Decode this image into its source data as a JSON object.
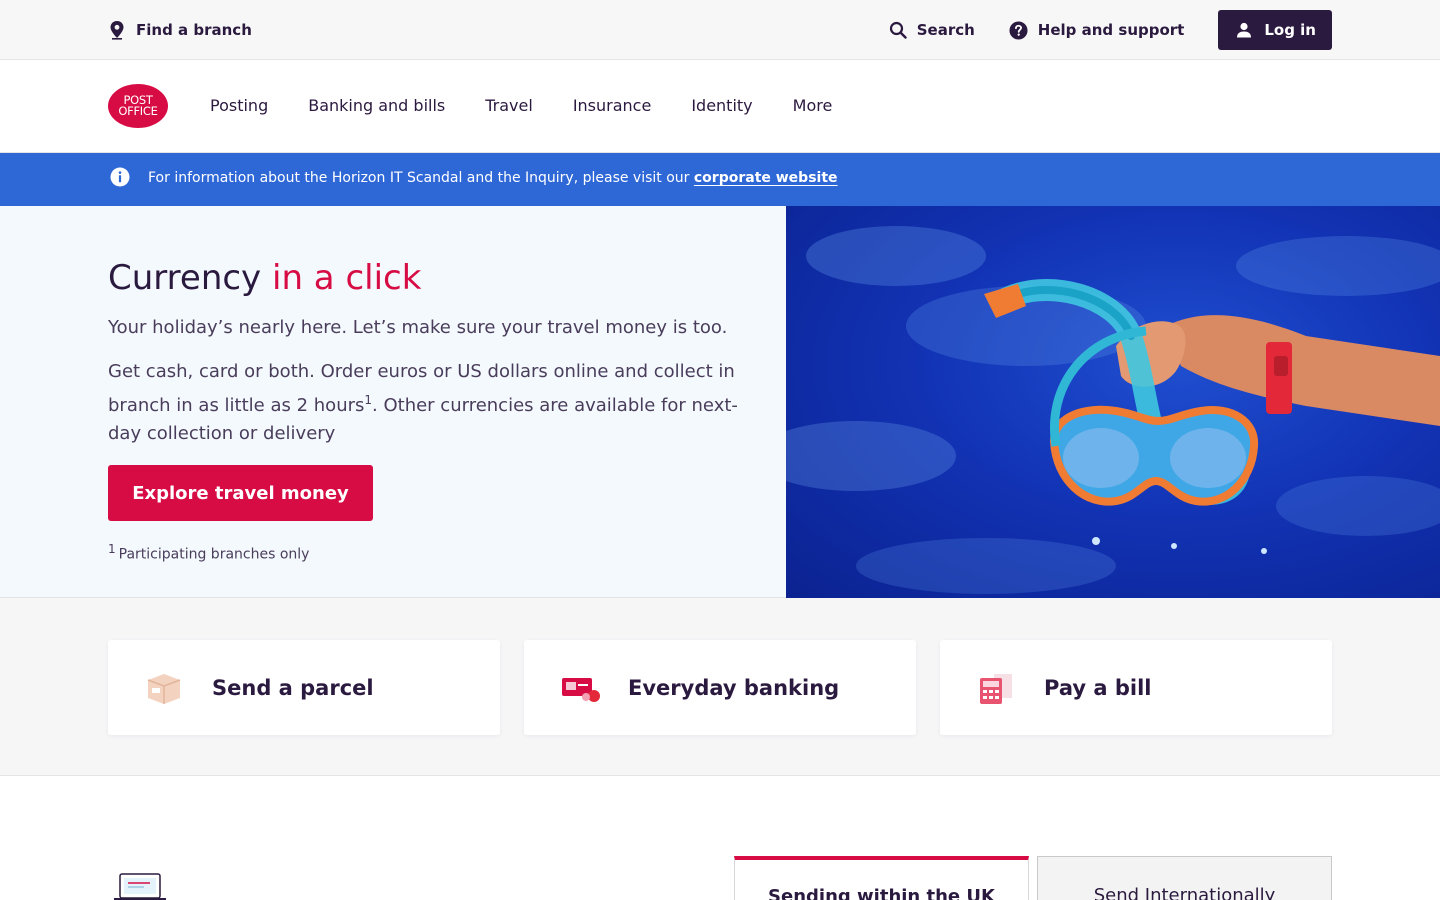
{
  "topbar": {
    "find_branch": "Find a branch",
    "search": "Search",
    "help": "Help and support",
    "login": "Log in"
  },
  "logo": {
    "line1": "POST",
    "line2": "OFFICE"
  },
  "nav": [
    "Posting",
    "Banking and bills",
    "Travel",
    "Insurance",
    "Identity",
    "More"
  ],
  "banner": {
    "text": "For information about the Horizon IT Scandal and the Inquiry, please visit our ",
    "link": "corporate website"
  },
  "hero": {
    "title_plain": "Currency ",
    "title_accent": "in a click",
    "p1": "Your holiday’s nearly here. Let’s make sure your travel money is too.",
    "p2_before": "Get cash, card or both. Order euros or US dollars online and collect in branch in as little as 2 hours",
    "p2_sup": "1",
    "p2_after": ". Other currencies are available for next-day collection or delivery",
    "cta": "Explore travel money",
    "footnote_sup": "1",
    "footnote": "Participating branches only"
  },
  "quick_links": {
    "parcel": "Send a parcel",
    "banking": "Everyday banking",
    "bill": "Pay a bill"
  },
  "tabs": {
    "uk": "Sending within the UK",
    "international": "Send Internationally"
  },
  "colors": {
    "brand_red": "#d70c45",
    "navy": "#2b1a3f",
    "banner_blue": "#2e67d6"
  }
}
